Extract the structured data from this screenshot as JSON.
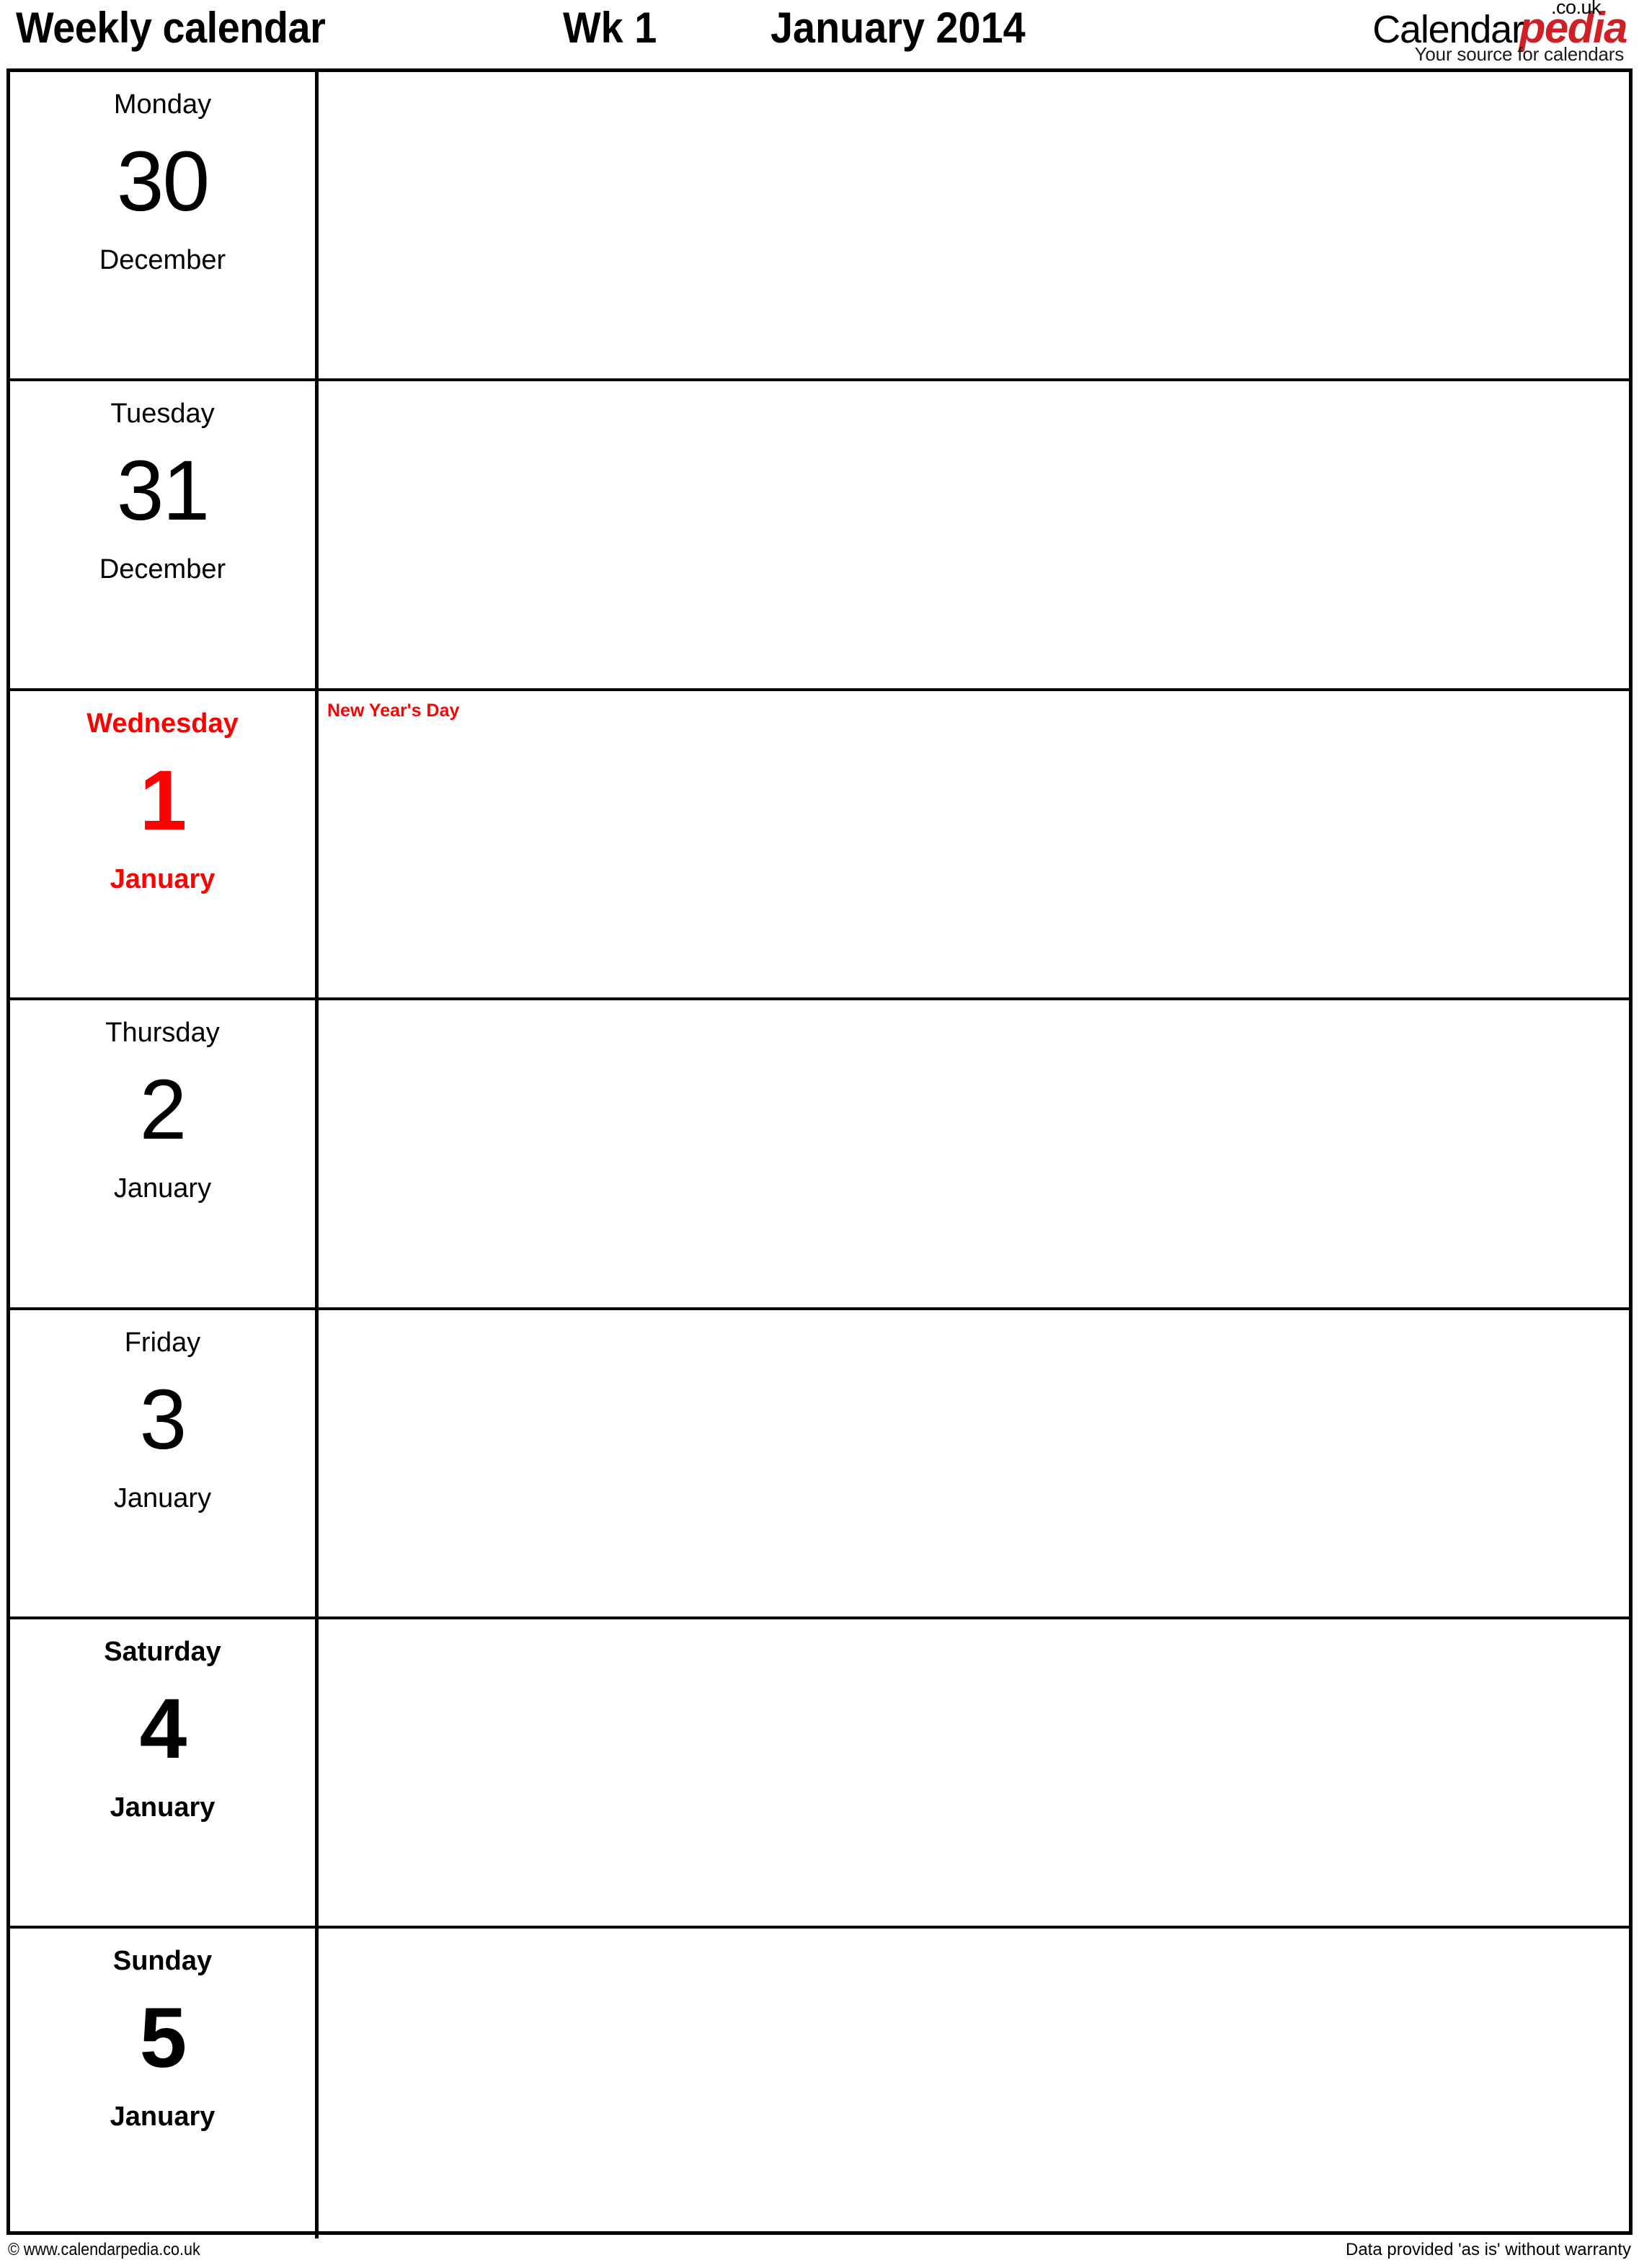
{
  "header": {
    "title": "Weekly calendar",
    "week_label": "Wk 1",
    "month_year": "January 2014"
  },
  "logo": {
    "brand_part1": "Calendar",
    "brand_part2": "pedia",
    "domain_suffix": ".co.uk",
    "tagline": "Your source for calendars",
    "brand_color": "#cf2027"
  },
  "calendar": {
    "days": [
      {
        "weekday": "Monday",
        "number": "30",
        "month": "December",
        "note": "",
        "weight": "wt-normal",
        "color": "clr-black"
      },
      {
        "weekday": "Tuesday",
        "number": "31",
        "month": "December",
        "note": "",
        "weight": "wt-normal",
        "color": "clr-black"
      },
      {
        "weekday": "Wednesday",
        "number": "1",
        "month": "January",
        "note": "New Year's Day",
        "weight": "wt-bold",
        "color": "clr-red"
      },
      {
        "weekday": "Thursday",
        "number": "2",
        "month": "January",
        "note": "",
        "weight": "wt-normal",
        "color": "clr-black"
      },
      {
        "weekday": "Friday",
        "number": "3",
        "month": "January",
        "note": "",
        "weight": "wt-normal",
        "color": "clr-black"
      },
      {
        "weekday": "Saturday",
        "number": "4",
        "month": "January",
        "note": "",
        "weight": "wt-bold",
        "color": "clr-black"
      },
      {
        "weekday": "Sunday",
        "number": "5",
        "month": "January",
        "note": "",
        "weight": "wt-bold",
        "color": "clr-black"
      }
    ]
  },
  "footer": {
    "copyright": "© www.calendarpedia.co.uk",
    "disclaimer": "Data provided 'as is' without warranty"
  }
}
